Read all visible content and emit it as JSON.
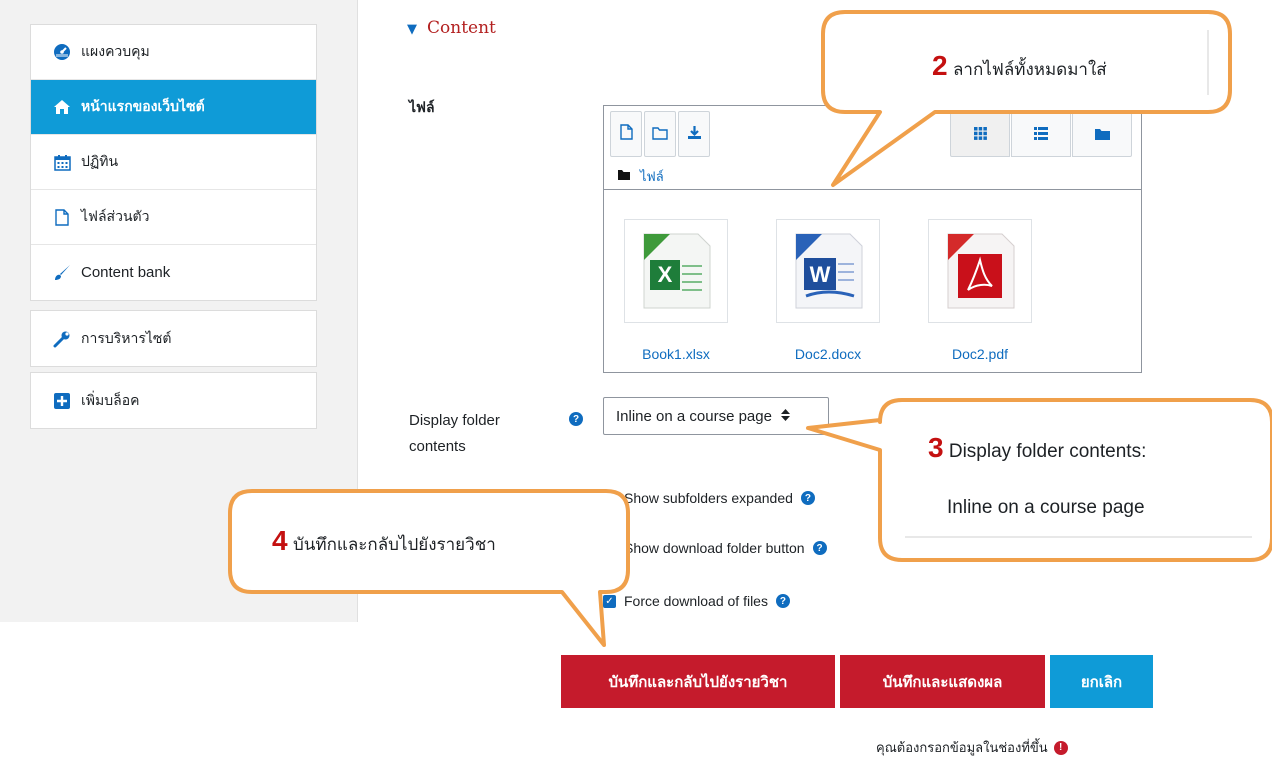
{
  "sidebar": {
    "groups": [
      {
        "items": [
          {
            "label": "แผงควบคุม",
            "icon": "dashboard-icon"
          },
          {
            "label": "หน้าแรกของเว็บไซต์",
            "icon": "home-icon",
            "active": true
          },
          {
            "label": "ปฏิทิน",
            "icon": "calendar-icon"
          },
          {
            "label": "ไฟล์ส่วนตัว",
            "icon": "file-icon"
          },
          {
            "label": "Content bank",
            "icon": "paintbrush-icon"
          }
        ]
      },
      {
        "items": [
          {
            "label": "การบริหารไซต์",
            "icon": "wrench-icon"
          }
        ]
      },
      {
        "items": [
          {
            "label": "เพิ่มบล็อค",
            "icon": "plus-square-icon"
          }
        ]
      }
    ]
  },
  "main": {
    "section_title": "Content",
    "files_label": "ไฟล์",
    "filemanager": {
      "path_label": "ไฟล์",
      "files": [
        {
          "name": "Book1.xlsx",
          "type": "excel"
        },
        {
          "name": "Doc2.docx",
          "type": "word"
        },
        {
          "name": "Doc2.pdf",
          "type": "pdf"
        }
      ]
    },
    "display_folder": {
      "label_line1": "Display folder",
      "label_line2": "contents",
      "help": "?",
      "selected": "Inline on a course page"
    },
    "checkboxes": [
      {
        "label": "Show subfolders expanded",
        "checked": true
      },
      {
        "label": "Show download folder button",
        "checked": true
      },
      {
        "label": "Force download of files",
        "checked": true
      }
    ],
    "buttons": {
      "save_return": "บันทึกและกลับไปยังรายวิชา",
      "save_display": "บันทึกและแสดงผล",
      "cancel": "ยกเลิก"
    },
    "required_note": "คุณต้องกรอกข้อมูลในช่องที่ขึ้น",
    "required_icon": "!"
  },
  "callouts": [
    {
      "number": "2",
      "text": "ลากไฟล์ทั้งหมดมาใส่"
    },
    {
      "number": "3",
      "line1": "Display folder contents:",
      "line2": "Inline on a course page"
    },
    {
      "number": "4",
      "text": "บันทึกและกลับไปยังรายวิชา"
    }
  ],
  "colors": {
    "accent_blue": "#0f9bd7",
    "save_red": "#c51b2c",
    "callout_border": "#f0a04b",
    "callout_number": "#c41010"
  }
}
